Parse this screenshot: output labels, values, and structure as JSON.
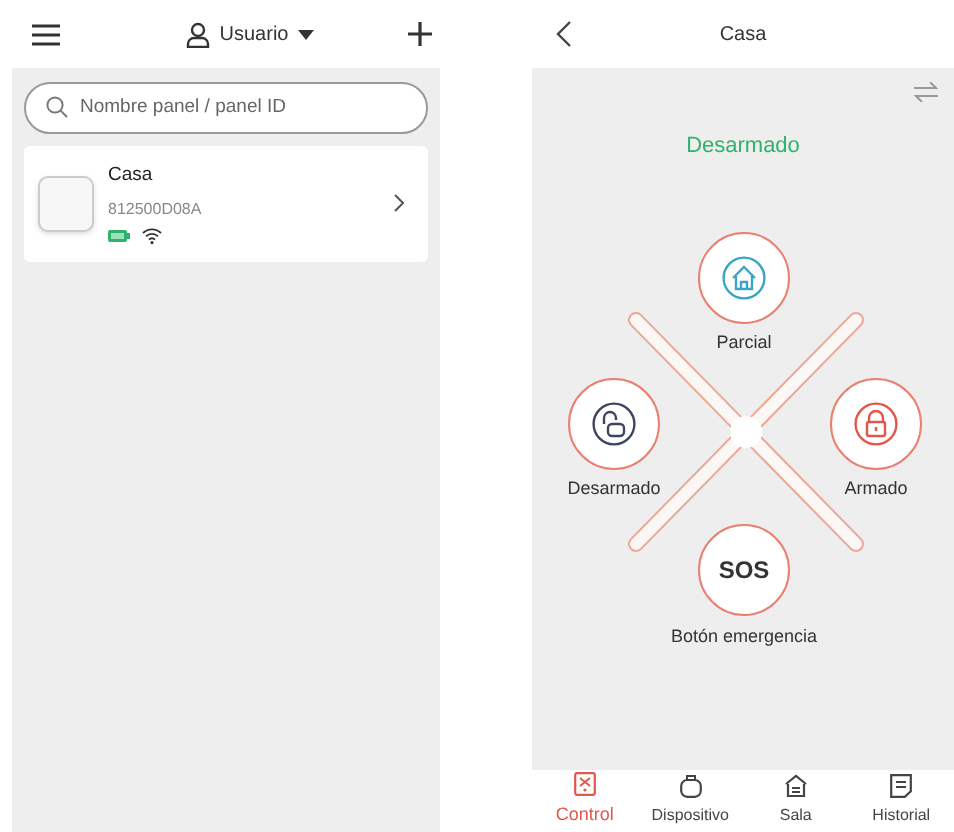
{
  "left_header": {
    "account": "Usuario"
  },
  "search": {
    "placeholder": "Nombre panel / panel ID"
  },
  "panels": [
    {
      "name": "Casa",
      "id": "812500D08A"
    }
  ],
  "right_header": {
    "title": "Casa"
  },
  "status": "Desarmado",
  "modes": [
    {
      "kind": "partial",
      "label": "Parcial"
    },
    {
      "kind": "disarm",
      "label": "Desarmado"
    },
    {
      "kind": "arm",
      "label": "Armado"
    },
    {
      "kind": "sos",
      "label": "Botón emergencia",
      "symbol": "SOS"
    }
  ],
  "nav": [
    {
      "kind": "control",
      "label": "Control",
      "selected": true
    },
    {
      "kind": "device",
      "label": "Dispositivo",
      "selected": false
    },
    {
      "kind": "room",
      "label": "Sala",
      "selected": false
    },
    {
      "kind": "history",
      "label": "Historial",
      "selected": false
    }
  ]
}
